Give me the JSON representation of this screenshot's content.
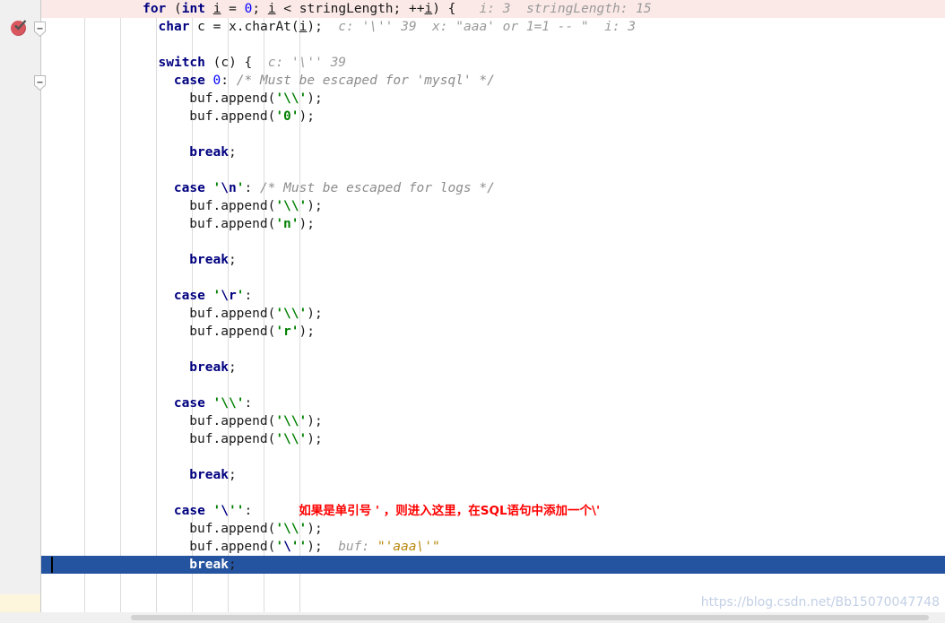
{
  "editor": {
    "gutter": {
      "breakpoint_icon": "breakpoint-verified-icon",
      "fold_markers": [
        "fold-collapse-icon",
        "fold-collapse-icon"
      ]
    },
    "watermark": "https://blog.csdn.net/Bb15070047748",
    "colors": {
      "keyword": "#000080",
      "string": "#008000",
      "number": "#0000ff",
      "comment": "#8c8c8c",
      "inline_hint": "#9a9a9a",
      "inline_hint_value": "#b8860b",
      "execution_line_bg": "#fbe9e7",
      "selection_bg": "#24539f",
      "gutter_bg": "#f0f0f0",
      "annotation_red": "#ff0000"
    },
    "annotation": "如果是单引号 ' ，则进入这里，在SQL语句中添加一个\\'",
    "lines": [
      {
        "n": 1,
        "state": "execution",
        "indent": 13,
        "tokens": [
          {
            "t": "for",
            "c": "kw"
          },
          {
            "t": " (",
            "c": "plain"
          },
          {
            "t": "int",
            "c": "kw"
          },
          {
            "t": " ",
            "c": "plain"
          },
          {
            "t": "i",
            "c": "field"
          },
          {
            "t": " = ",
            "c": "plain"
          },
          {
            "t": "0",
            "c": "num"
          },
          {
            "t": "; ",
            "c": "plain"
          },
          {
            "t": "i",
            "c": "field"
          },
          {
            "t": " < stringLength; ++",
            "c": "plain"
          },
          {
            "t": "i",
            "c": "field"
          },
          {
            "t": ") {",
            "c": "plain"
          },
          {
            "t": "   i: 3  stringLength: 15",
            "c": "hint"
          }
        ]
      },
      {
        "n": 2,
        "state": "normal",
        "indent": 15,
        "tokens": [
          {
            "t": "char",
            "c": "kw"
          },
          {
            "t": " c = x.charAt(",
            "c": "plain"
          },
          {
            "t": "i",
            "c": "field"
          },
          {
            "t": ");",
            "c": "plain"
          },
          {
            "t": "  c: '\\'' 39  x: \"aaa' or 1=1 -- \"  i: 3",
            "c": "hint"
          }
        ]
      },
      {
        "n": 3,
        "state": "normal",
        "indent": 0,
        "tokens": []
      },
      {
        "n": 4,
        "state": "normal",
        "indent": 15,
        "tokens": [
          {
            "t": "switch",
            "c": "kw"
          },
          {
            "t": " (c) {",
            "c": "plain"
          },
          {
            "t": "  c: '\\'' 39",
            "c": "hint"
          }
        ]
      },
      {
        "n": 5,
        "state": "normal",
        "indent": 17,
        "tokens": [
          {
            "t": "case",
            "c": "kw"
          },
          {
            "t": " ",
            "c": "plain"
          },
          {
            "t": "0",
            "c": "num"
          },
          {
            "t": ": ",
            "c": "plain"
          },
          {
            "t": "/* Must be escaped for 'mysql' */",
            "c": "cmt"
          }
        ]
      },
      {
        "n": 6,
        "state": "normal",
        "indent": 19,
        "tokens": [
          {
            "t": "buf.append(",
            "c": "plain"
          },
          {
            "t": "'\\\\'",
            "c": "str"
          },
          {
            "t": ");",
            "c": "plain"
          }
        ]
      },
      {
        "n": 7,
        "state": "normal",
        "indent": 19,
        "tokens": [
          {
            "t": "buf.append(",
            "c": "plain"
          },
          {
            "t": "'0'",
            "c": "str"
          },
          {
            "t": ");",
            "c": "plain"
          }
        ]
      },
      {
        "n": 8,
        "state": "normal",
        "indent": 0,
        "tokens": []
      },
      {
        "n": 9,
        "state": "normal",
        "indent": 19,
        "tokens": [
          {
            "t": "break",
            "c": "kw"
          },
          {
            "t": ";",
            "c": "plain"
          }
        ]
      },
      {
        "n": 10,
        "state": "normal",
        "indent": 0,
        "tokens": []
      },
      {
        "n": 11,
        "state": "normal",
        "indent": 17,
        "tokens": [
          {
            "t": "case",
            "c": "kw"
          },
          {
            "t": " ",
            "c": "plain"
          },
          {
            "t": "'",
            "c": "str"
          },
          {
            "t": "\\n",
            "c": "esc"
          },
          {
            "t": "'",
            "c": "str"
          },
          {
            "t": ": ",
            "c": "plain"
          },
          {
            "t": "/* Must be escaped for logs */",
            "c": "cmt"
          }
        ]
      },
      {
        "n": 12,
        "state": "normal",
        "indent": 19,
        "tokens": [
          {
            "t": "buf.append(",
            "c": "plain"
          },
          {
            "t": "'\\\\'",
            "c": "str"
          },
          {
            "t": ");",
            "c": "plain"
          }
        ]
      },
      {
        "n": 13,
        "state": "normal",
        "indent": 19,
        "tokens": [
          {
            "t": "buf.append(",
            "c": "plain"
          },
          {
            "t": "'n'",
            "c": "str"
          },
          {
            "t": ");",
            "c": "plain"
          }
        ]
      },
      {
        "n": 14,
        "state": "normal",
        "indent": 0,
        "tokens": []
      },
      {
        "n": 15,
        "state": "normal",
        "indent": 19,
        "tokens": [
          {
            "t": "break",
            "c": "kw"
          },
          {
            "t": ";",
            "c": "plain"
          }
        ]
      },
      {
        "n": 16,
        "state": "normal",
        "indent": 0,
        "tokens": []
      },
      {
        "n": 17,
        "state": "normal",
        "indent": 17,
        "tokens": [
          {
            "t": "case",
            "c": "kw"
          },
          {
            "t": " ",
            "c": "plain"
          },
          {
            "t": "'",
            "c": "str"
          },
          {
            "t": "\\r",
            "c": "esc"
          },
          {
            "t": "'",
            "c": "str"
          },
          {
            "t": ":",
            "c": "plain"
          }
        ]
      },
      {
        "n": 18,
        "state": "normal",
        "indent": 19,
        "tokens": [
          {
            "t": "buf.append(",
            "c": "plain"
          },
          {
            "t": "'\\\\'",
            "c": "str"
          },
          {
            "t": ");",
            "c": "plain"
          }
        ]
      },
      {
        "n": 19,
        "state": "normal",
        "indent": 19,
        "tokens": [
          {
            "t": "buf.append(",
            "c": "plain"
          },
          {
            "t": "'r'",
            "c": "str"
          },
          {
            "t": ");",
            "c": "plain"
          }
        ]
      },
      {
        "n": 20,
        "state": "normal",
        "indent": 0,
        "tokens": []
      },
      {
        "n": 21,
        "state": "normal",
        "indent": 19,
        "tokens": [
          {
            "t": "break",
            "c": "kw"
          },
          {
            "t": ";",
            "c": "plain"
          }
        ]
      },
      {
        "n": 22,
        "state": "normal",
        "indent": 0,
        "tokens": []
      },
      {
        "n": 23,
        "state": "normal",
        "indent": 17,
        "tokens": [
          {
            "t": "case",
            "c": "kw"
          },
          {
            "t": " ",
            "c": "plain"
          },
          {
            "t": "'\\\\'",
            "c": "str"
          },
          {
            "t": ":",
            "c": "plain"
          }
        ]
      },
      {
        "n": 24,
        "state": "normal",
        "indent": 19,
        "tokens": [
          {
            "t": "buf.append(",
            "c": "plain"
          },
          {
            "t": "'\\\\'",
            "c": "str"
          },
          {
            "t": ");",
            "c": "plain"
          }
        ]
      },
      {
        "n": 25,
        "state": "normal",
        "indent": 19,
        "tokens": [
          {
            "t": "buf.append(",
            "c": "plain"
          },
          {
            "t": "'\\\\'",
            "c": "str"
          },
          {
            "t": ");",
            "c": "plain"
          }
        ]
      },
      {
        "n": 26,
        "state": "normal",
        "indent": 0,
        "tokens": []
      },
      {
        "n": 27,
        "state": "normal",
        "indent": 19,
        "tokens": [
          {
            "t": "break",
            "c": "kw"
          },
          {
            "t": ";",
            "c": "plain"
          }
        ]
      },
      {
        "n": 28,
        "state": "normal",
        "indent": 0,
        "tokens": []
      },
      {
        "n": 29,
        "state": "normal",
        "indent": 17,
        "annotated": true,
        "tokens": [
          {
            "t": "case",
            "c": "kw"
          },
          {
            "t": " ",
            "c": "plain"
          },
          {
            "t": "'",
            "c": "str"
          },
          {
            "t": "\\",
            "c": "esc"
          },
          {
            "t": "''",
            "c": "str"
          },
          {
            "t": ":",
            "c": "plain"
          }
        ]
      },
      {
        "n": 30,
        "state": "normal",
        "indent": 19,
        "tokens": [
          {
            "t": "buf.append(",
            "c": "plain"
          },
          {
            "t": "'\\\\'",
            "c": "str"
          },
          {
            "t": ");",
            "c": "plain"
          }
        ]
      },
      {
        "n": 31,
        "state": "normal",
        "indent": 19,
        "tokens": [
          {
            "t": "buf.append(",
            "c": "plain"
          },
          {
            "t": "'",
            "c": "str"
          },
          {
            "t": "\\",
            "c": "esc"
          },
          {
            "t": "''",
            "c": "str"
          },
          {
            "t": ");",
            "c": "plain"
          },
          {
            "t": "  buf: ",
            "c": "hint"
          },
          {
            "t": "\"'aaa\\'\"",
            "c": "hintval"
          }
        ]
      },
      {
        "n": 32,
        "state": "selected",
        "indent": 19,
        "tokens": [
          {
            "t": "break",
            "c": "kw"
          },
          {
            "t": ";",
            "c": "plain"
          }
        ]
      }
    ]
  }
}
